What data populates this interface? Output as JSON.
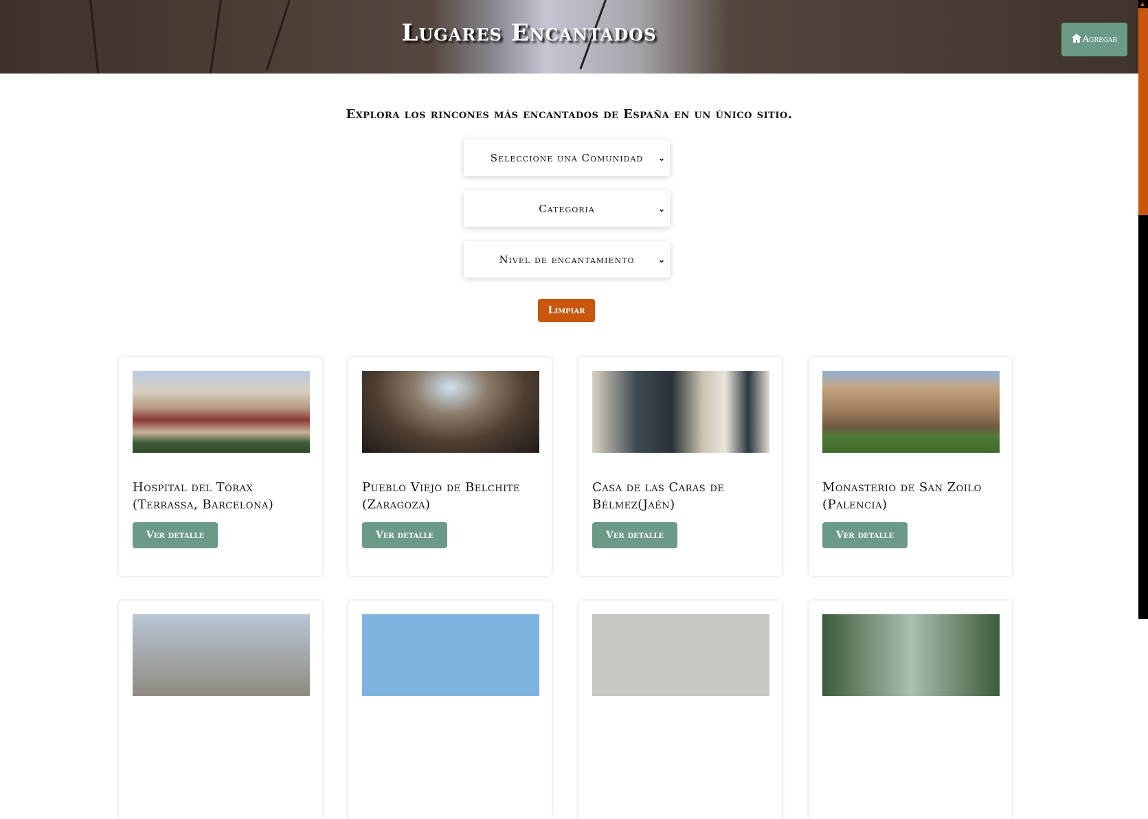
{
  "header": {
    "title": "Lugares Encantados",
    "add_label": "Agregar",
    "add_icon": "home-icon"
  },
  "tagline": "Explora los rincones más encantados de España en un único sitio.",
  "filters": {
    "community": "Seleccione una Comunidad",
    "category": "Categoria",
    "level": "Nivel de encantamiento"
  },
  "clear_label": "Limpiar",
  "colors": {
    "accent_green": "#6b9a87",
    "accent_orange": "#c9560d"
  },
  "cards": [
    {
      "title": "Hospital del Tórax (Terrassa, Barcelona)",
      "button": "Ver detalle"
    },
    {
      "title": "Pueblo Viejo de Belchite (Zaragoza)",
      "button": "Ver detalle"
    },
    {
      "title": "Casa de las Caras de Bélmez(Jaén)",
      "button": "Ver detalle"
    },
    {
      "title": "Monasterio de San Zoilo (Palencia)",
      "button": "Ver detalle"
    }
  ]
}
